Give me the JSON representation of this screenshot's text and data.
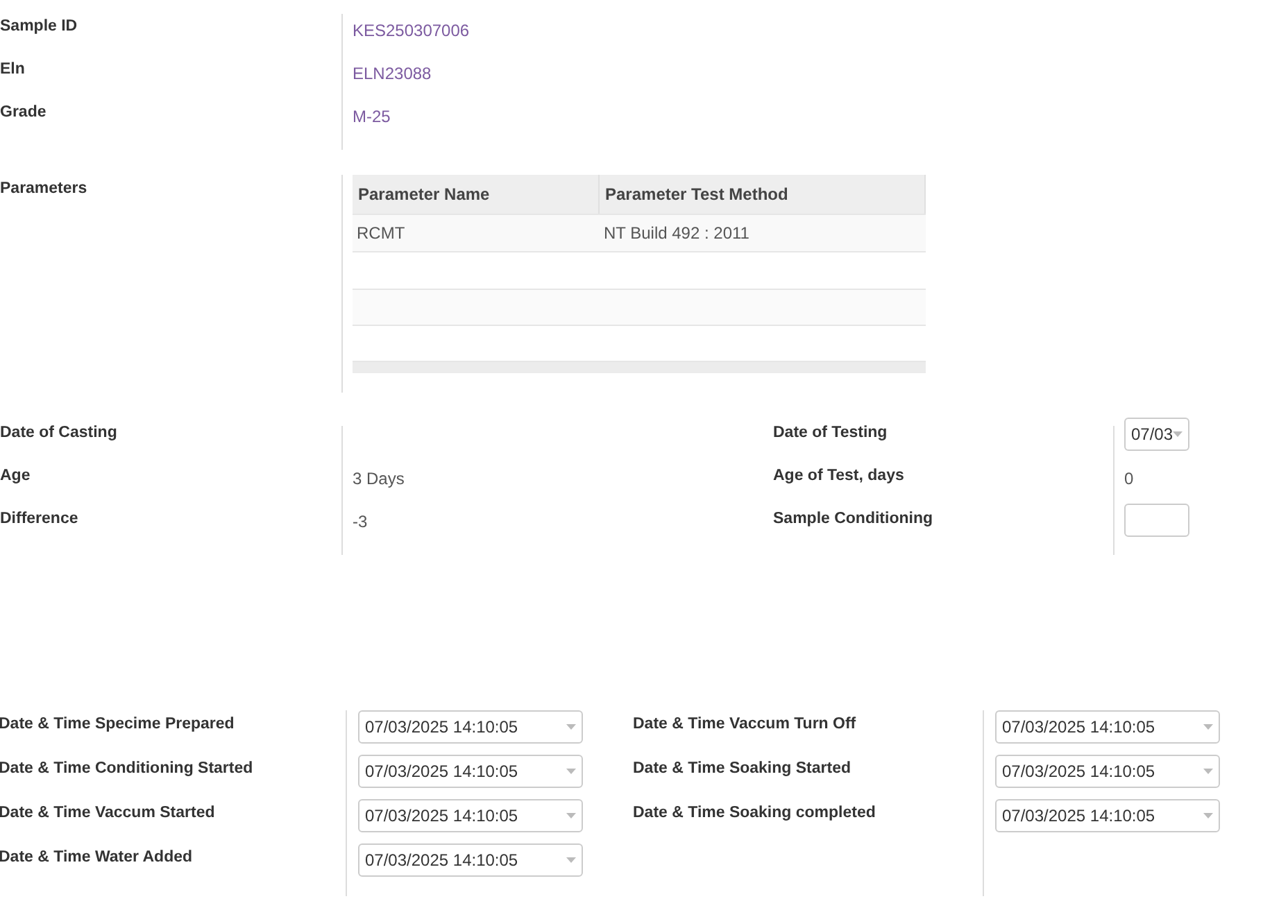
{
  "header_fields": [
    {
      "label": "Sample ID",
      "value": "KES250307006"
    },
    {
      "label": "Eln",
      "value": "ELN23088"
    },
    {
      "label": "Grade",
      "value": "M-25"
    }
  ],
  "parameters": {
    "label": "Parameters",
    "columns": [
      "Parameter Name",
      "Parameter Test Method"
    ],
    "rows": [
      [
        "RCMT",
        "NT Build 492 : 2011"
      ]
    ]
  },
  "test_info": {
    "left": [
      {
        "label": "Date of Casting",
        "kind": "text"
      },
      {
        "label": "Age",
        "kind": "text",
        "value": "3 Days"
      },
      {
        "label": "Difference",
        "kind": "text",
        "value": "-3"
      }
    ],
    "right": [
      {
        "label": "Date of Testing",
        "kind": "date",
        "value": "07/03"
      },
      {
        "label": "Age of Test, days",
        "kind": "text",
        "value": "0"
      },
      {
        "label": "Sample Conditioning",
        "kind": "input"
      }
    ]
  },
  "timeline": {
    "left": [
      {
        "label": "Date & Time Specime Prepared",
        "value": "07/03/2025 14:10:05"
      },
      {
        "label": "Date & Time Conditioning Started",
        "value": "07/03/2025 14:10:05"
      },
      {
        "label": "Date & Time Vaccum Started",
        "value": "07/03/2025 14:10:05"
      },
      {
        "label": "Date & Time Water Added",
        "value": "07/03/2025 14:10:05"
      }
    ],
    "right": [
      {
        "label": "Date & Time Vaccum Turn Off",
        "value": "07/03/2025 14:10:05"
      },
      {
        "label": "Date & Time Soaking Started",
        "value": "07/03/2025 14:10:05"
      },
      {
        "label": "Date & Time Soaking completed",
        "value": "07/03/2025 14:10:05"
      }
    ]
  }
}
